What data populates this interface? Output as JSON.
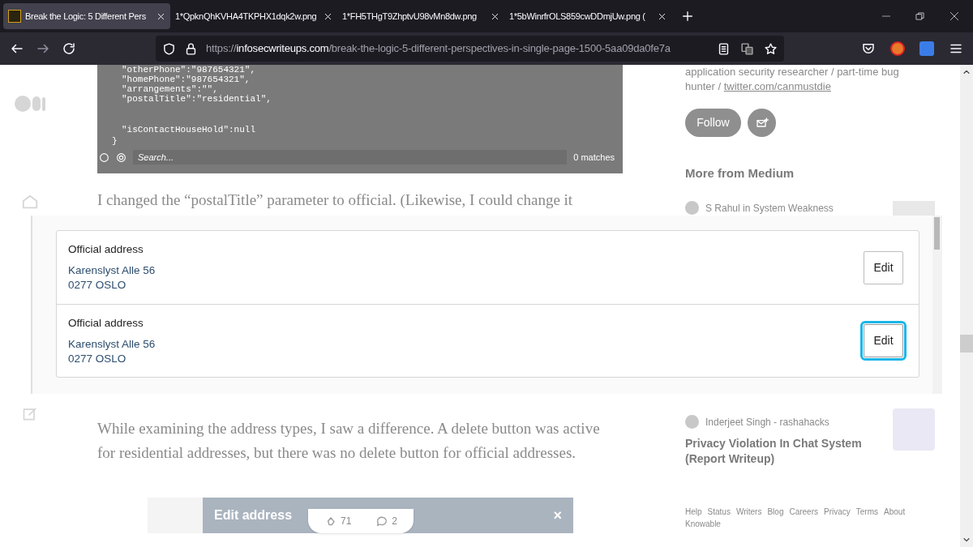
{
  "browser": {
    "tabs": [
      {
        "title": "Break the Logic: 5 Different Pers",
        "selected": true
      },
      {
        "title": "1*QpknQhKVHA4TKPHX1dqk2w.png",
        "selected": false
      },
      {
        "title": "1*FH5THgT9ZhptvU98vMn8dw.png",
        "selected": false
      },
      {
        "title": "1*5bWinrfrOLS859cwDDmjUw.png (",
        "selected": false
      }
    ],
    "url": {
      "scheme": "https://",
      "host": "infosecwriteups.com",
      "path": "/break-the-logic-5-different-perspectives-in-single-page-1500-5aa09da0fe7a"
    }
  },
  "article": {
    "code_lines": [
      "\"otherPhone\":\"987654321\",",
      "\"homePhone\":\"987654321\",",
      "\"arrangements\":\"\",",
      "\"postalTitle\":\"residential\",",
      "\"isContactHouseHold\":null",
      "}"
    ],
    "code_search": {
      "placeholder": "Search...",
      "matches": "0 matches"
    },
    "paragraph_1": "I changed the “postalTitle” parameter to official. (Likewise, I could change it",
    "paragraph_2": "While examining the address types, I saw a difference. A delete button was active for residential addresses, but there was no delete button for official addresses.",
    "image_title": "Edit address",
    "image_close": "×",
    "claps": "71",
    "responses": "2"
  },
  "sidebar": {
    "bio": "application security researcher / part-time bug hunter / ",
    "bio_link": "twitter.com/canmustdie",
    "follow": "Follow",
    "more_heading": "More from Medium",
    "stories": [
      {
        "author": "S Rahul",
        "connector": "in",
        "publication": "System Weakness"
      },
      {
        "author": "Inderjeet Singh - rashahacks",
        "title": "Privacy Violation In Chat System (Report Writeup)"
      }
    ],
    "footer_links": [
      "Help",
      "Status",
      "Writers",
      "Blog",
      "Careers",
      "Privacy",
      "Terms",
      "About",
      "Knowable"
    ]
  },
  "address_image": {
    "addresses": [
      {
        "type": "Official address",
        "street": "Karenslyst Alle 56",
        "city": "0277 OSLO",
        "button": "Edit",
        "focused": false
      },
      {
        "type": "Official address",
        "street": "Karenslyst Alle 56",
        "city": "0277 OSLO",
        "button": "Edit",
        "focused": true
      }
    ]
  }
}
